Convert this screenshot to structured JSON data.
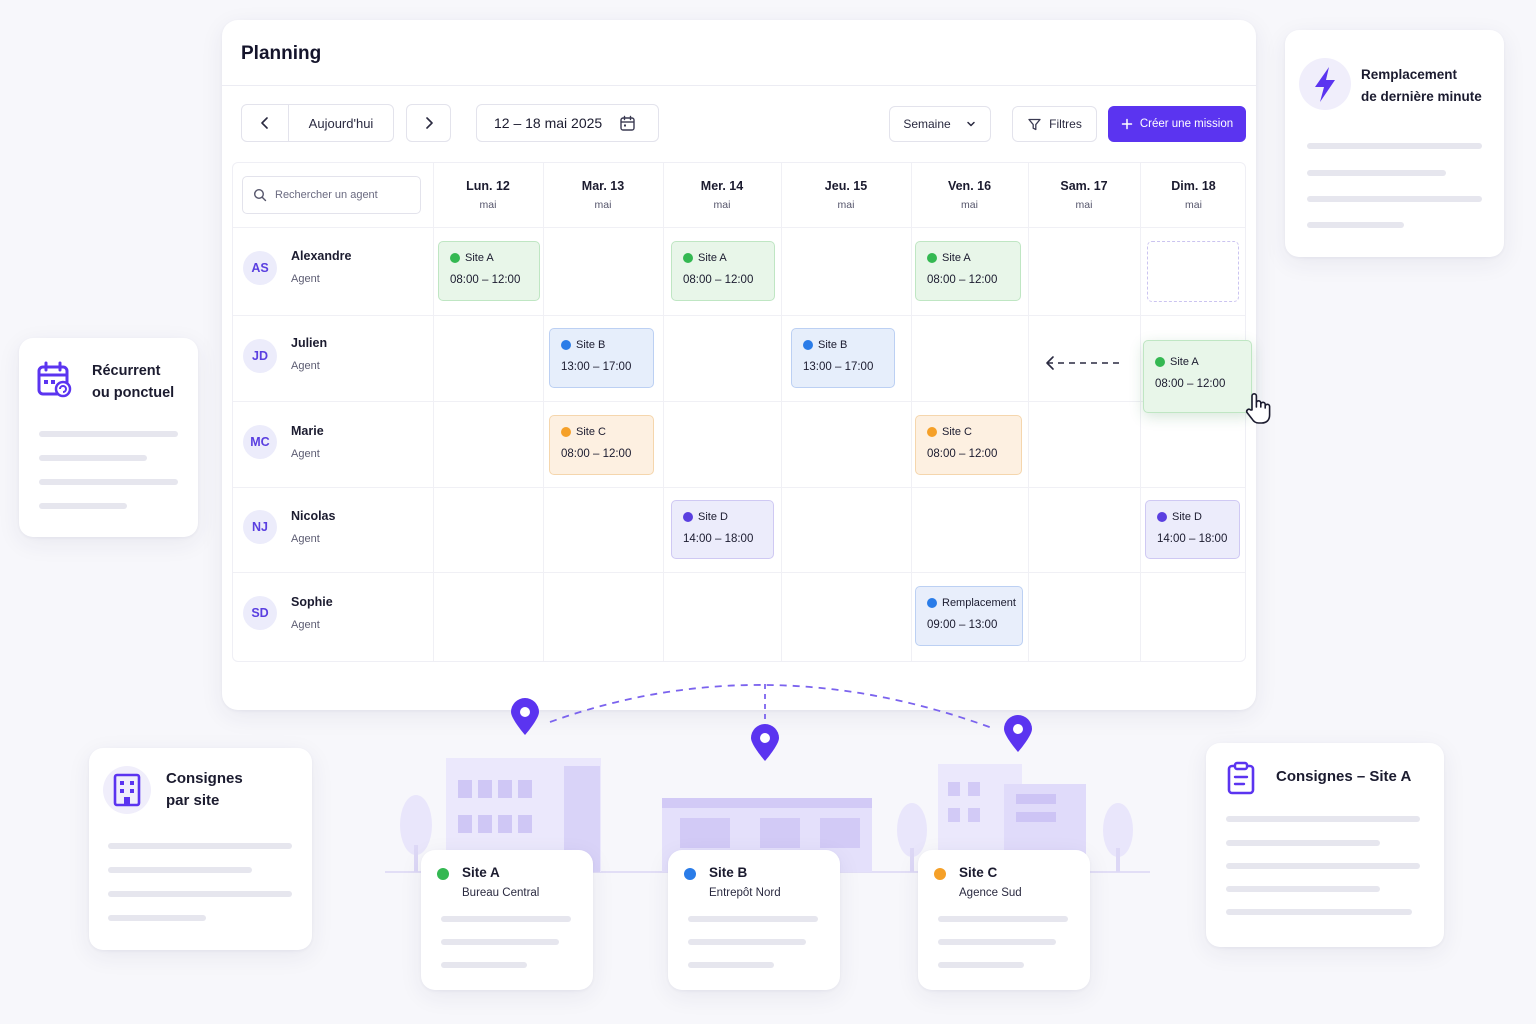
{
  "header": {
    "title": "Planning",
    "today_label": "Aujourd'hui",
    "date_range": "12 – 18 mai 2025",
    "view_select": "Semaine",
    "filters_label": "Filtres",
    "create_label": "Créer une mission"
  },
  "search": {
    "placeholder": "Rechercher un agent"
  },
  "days": [
    {
      "name": "Lun. 12",
      "month": "mai"
    },
    {
      "name": "Mar. 13",
      "month": "mai"
    },
    {
      "name": "Mer. 14",
      "month": "mai"
    },
    {
      "name": "Jeu. 15",
      "month": "mai"
    },
    {
      "name": "Ven. 16",
      "month": "mai"
    },
    {
      "name": "Sam. 17",
      "month": "mai"
    },
    {
      "name": "Dim. 18",
      "month": "mai"
    }
  ],
  "agents": [
    {
      "initials": "AS",
      "name": "Alexandre",
      "role": "Agent"
    },
    {
      "initials": "JD",
      "name": "Julien",
      "role": "Agent"
    },
    {
      "initials": "MC",
      "name": "Marie",
      "role": "Agent"
    },
    {
      "initials": "NJ",
      "name": "Nicolas",
      "role": "Agent"
    },
    {
      "initials": "SD",
      "name": "Sophie",
      "role": "Agent"
    }
  ],
  "shifts": [
    {
      "site": "Site A",
      "time": "08:00 – 12:00"
    },
    {
      "site": "Site A",
      "time": "08:00 – 12:00"
    },
    {
      "site": "Site A",
      "time": "08:00 – 12:00"
    },
    {
      "site": "Site B",
      "time": "13:00 – 17:00"
    },
    {
      "site": "Site B",
      "time": "13:00 – 17:00"
    },
    {
      "site": "Site A",
      "time": "08:00 – 12:00"
    },
    {
      "site": "Site C",
      "time": "08:00 – 12:00"
    },
    {
      "site": "Site C",
      "time": "08:00 – 12:00"
    },
    {
      "site": "Site D",
      "time": "14:00 – 18:00"
    },
    {
      "site": "Site D",
      "time": "14:00 – 18:00"
    },
    {
      "site": "Remplacement",
      "time": "09:00 – 13:00"
    }
  ],
  "colors": {
    "accent": "#5b34f0",
    "site_a": "#34b852",
    "site_b": "#2a7ce8",
    "site_c": "#f5a028",
    "site_d": "#5a3fe0"
  },
  "feature_cards": {
    "replacement": "Remplacement\nde dernière minute",
    "recurring": "Récurrent\nou ponctuel",
    "site_instructions": "Consignes\npar site",
    "site_a_instructions": "Consignes – Site A"
  },
  "sites": [
    {
      "name": "Site A",
      "subtitle": "Bureau Central"
    },
    {
      "name": "Site B",
      "subtitle": "Entrepôt Nord"
    },
    {
      "name": "Site C",
      "subtitle": "Agence Sud"
    }
  ],
  "icons": {
    "prev": "chevron-left-icon",
    "next": "chevron-right-icon",
    "calendar": "calendar-icon",
    "dropdown": "chevron-down-icon",
    "filter": "filter-icon",
    "plus": "plus-icon",
    "search": "search-icon",
    "bolt": "lightning-icon",
    "recurring": "calendar-repeat-icon",
    "building": "building-icon",
    "clipboard": "clipboard-icon",
    "pin": "map-pin-icon",
    "cursor": "hand-cursor-icon"
  }
}
